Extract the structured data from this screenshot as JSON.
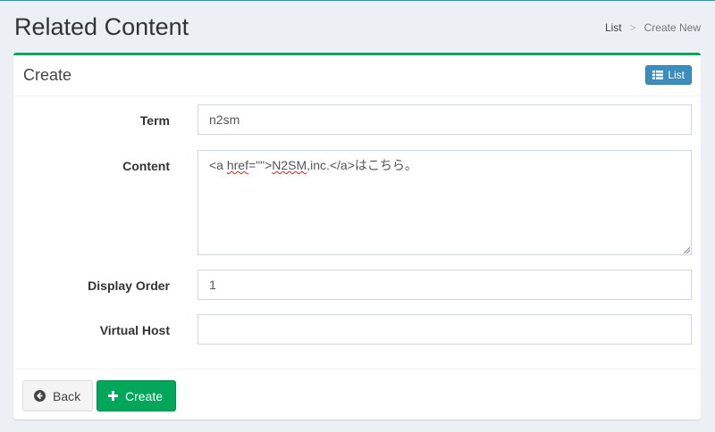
{
  "header": {
    "title": "Related Content",
    "breadcrumb": [
      {
        "label": "List"
      },
      {
        "label": "Create New"
      }
    ],
    "breadcrumb_separator": ">"
  },
  "box": {
    "title": "Create",
    "list_button_label": "List",
    "accent_color": "#00a65a"
  },
  "form": {
    "term": {
      "label": "Term",
      "value": "n2sm"
    },
    "content": {
      "label": "Content",
      "value_parts": [
        "<a ",
        "href",
        "=\"\">",
        "N2SM",
        ",inc.</a>はこちら。"
      ]
    },
    "display_order": {
      "label": "Display Order",
      "value": "1"
    },
    "virtual_host": {
      "label": "Virtual Host",
      "value": ""
    }
  },
  "footer": {
    "back_label": "Back",
    "create_label": "Create"
  },
  "colors": {
    "primary": "#3c8dbc",
    "success": "#00a65a",
    "background": "#ecf0f5"
  },
  "icons": {
    "list_button": "list-icon",
    "back_button": "arrow-circle-left-icon",
    "create_button": "plus-icon"
  }
}
